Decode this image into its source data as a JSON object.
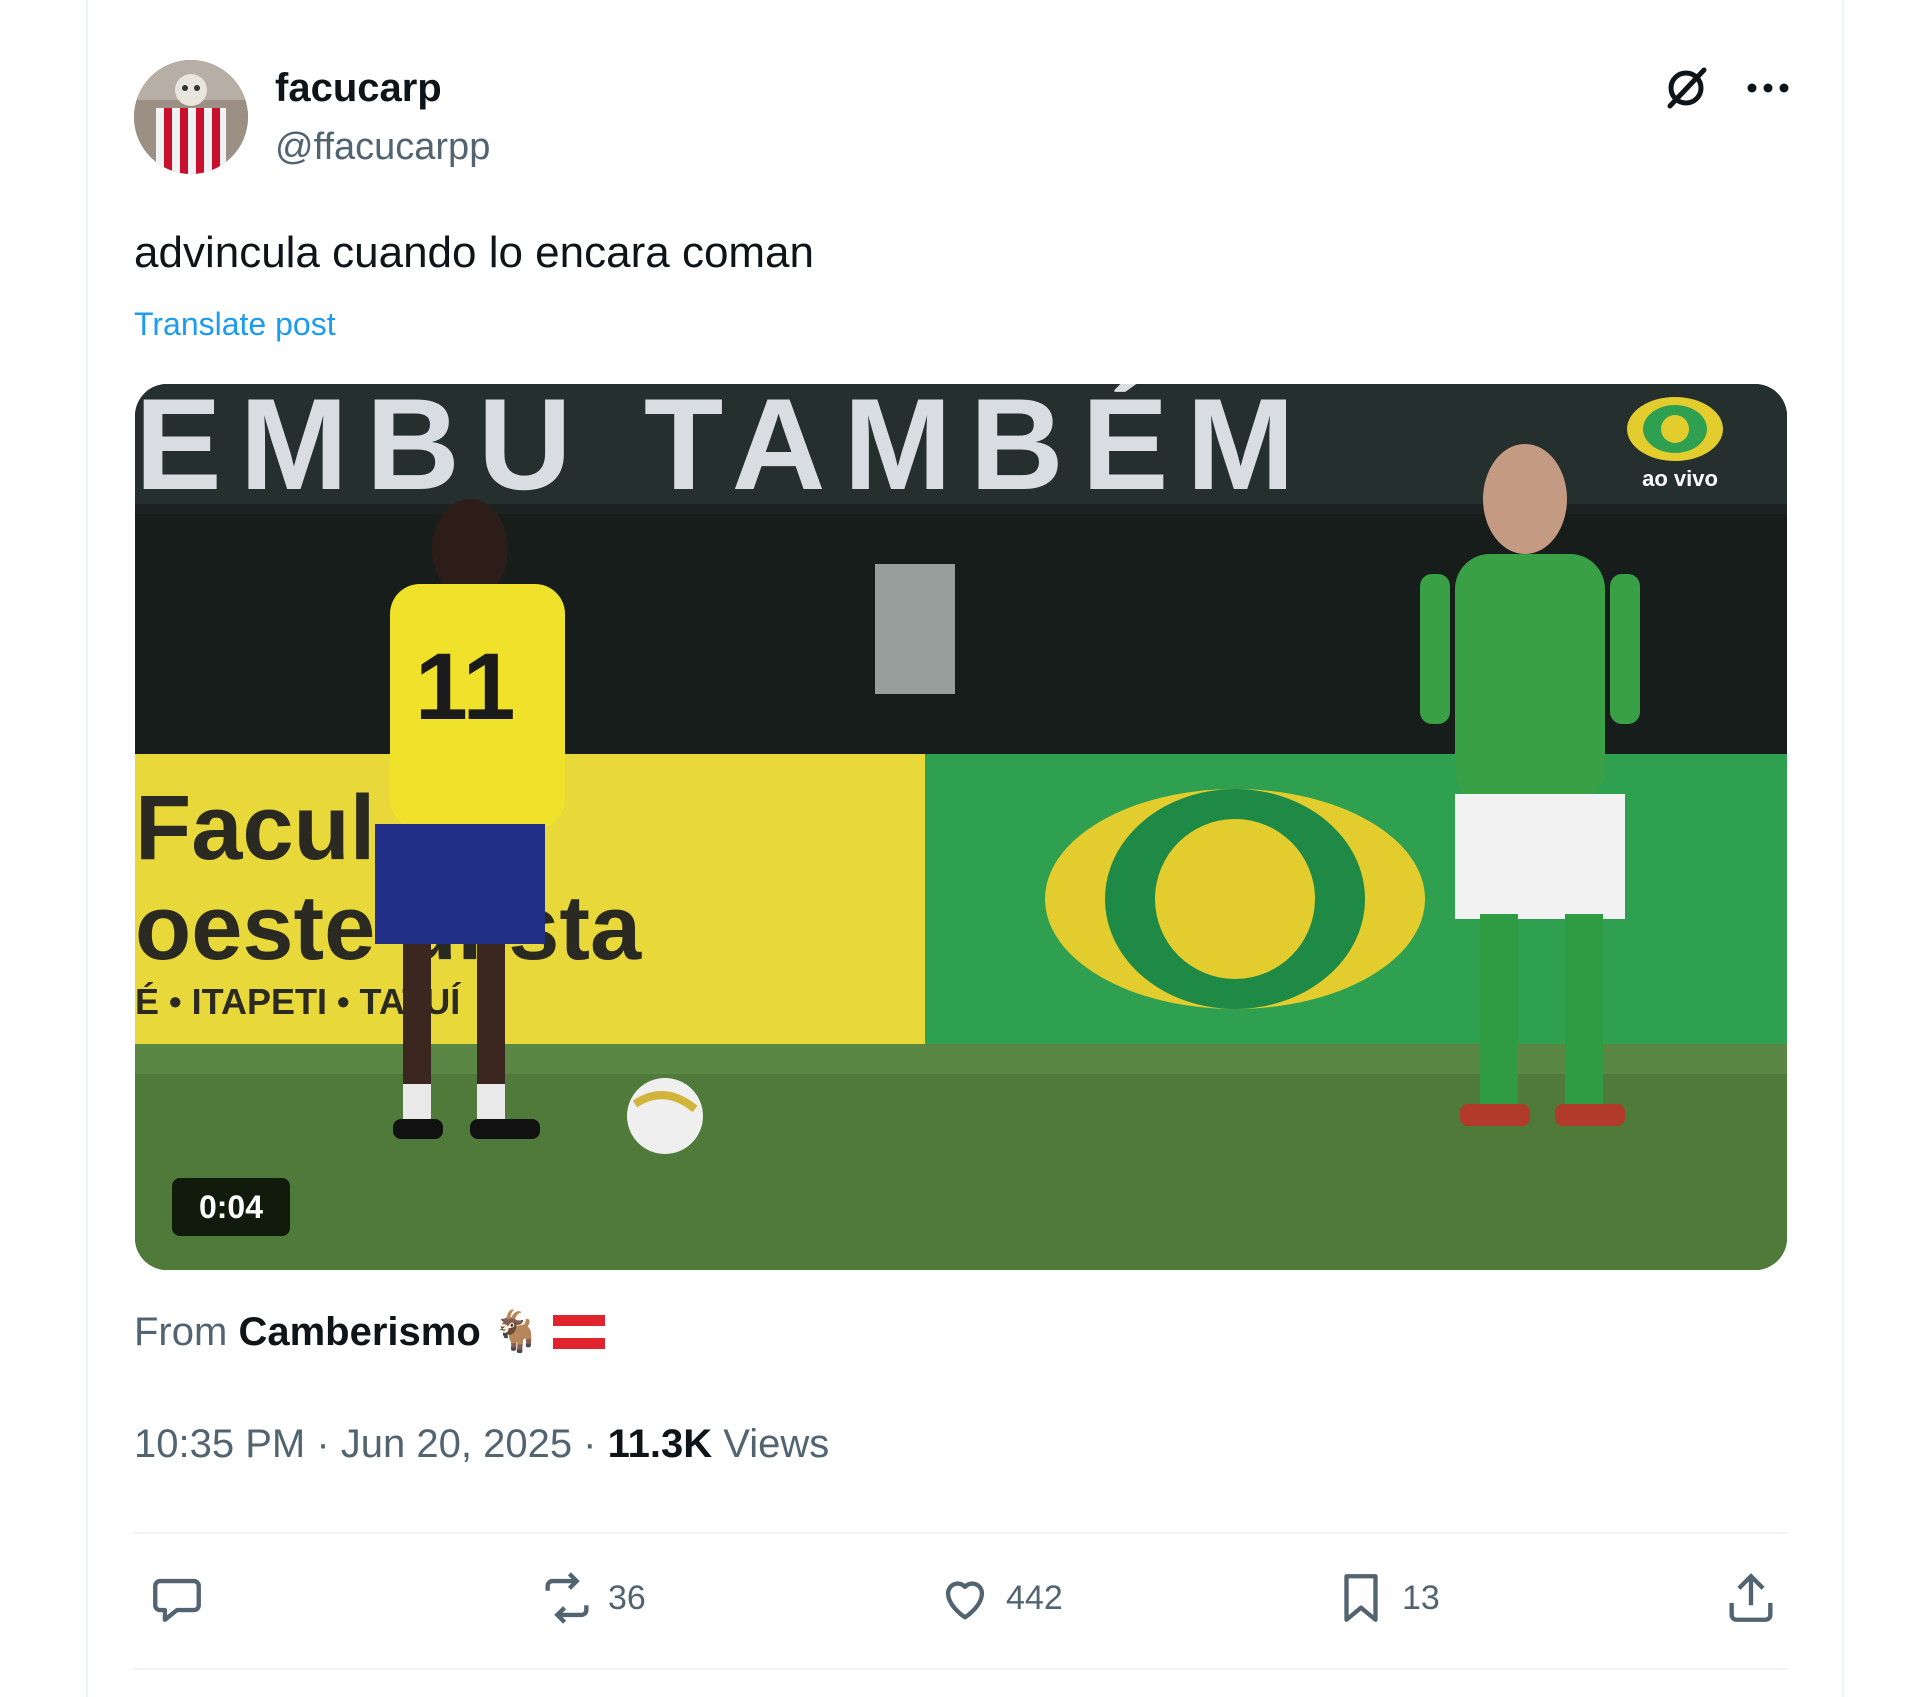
{
  "tweet": {
    "display_name": "facucarp",
    "handle": "@ffacucarpp",
    "text": "advincula cuando lo encara coman",
    "translate_label": "Translate post",
    "from_prefix": "From",
    "from_source": "Camberismo",
    "from_emoji": "🐐",
    "timestamp": "10:35 PM · Jun 20, 2025 ·",
    "views_count": "11.3K",
    "views_label": "Views"
  },
  "video": {
    "duration": "0:04",
    "banner_text": "EMBU TAMBÉM",
    "broadcast_badge": "ao vivo",
    "ad_line1": "Facul  de",
    "ad_line2": "oeste  ulista",
    "ad_line3": "É • ITAPETI   • TATUÍ",
    "jersey_number": "11"
  },
  "actions": {
    "reply": {
      "icon": "reply-icon",
      "count": ""
    },
    "retweet": {
      "icon": "retweet-icon",
      "count": "36"
    },
    "like": {
      "icon": "heart-icon",
      "count": "442"
    },
    "bookmark": {
      "icon": "bookmark-icon",
      "count": "13"
    },
    "share": {
      "icon": "share-icon",
      "count": ""
    }
  },
  "colors": {
    "link": "#1d9bf0",
    "secondary_text": "#536471",
    "primary_text": "#0f1419"
  }
}
